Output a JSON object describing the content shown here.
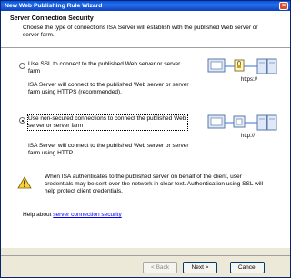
{
  "window": {
    "title": "New Web Publishing Rule Wizard",
    "close_glyph": "×"
  },
  "header": {
    "title": "Server Connection Security",
    "description": "Choose the type of connections ISA Server will establish with the published Web server or server farm."
  },
  "options": [
    {
      "label": "Use SSL to connect to the published Web server or server farm",
      "description": "ISA Server will connect to the published Web server or server farm using HTTPS (recommended).",
      "selected": false,
      "illustration_label": "https://"
    },
    {
      "label": "Use non-secured connections to connect the published Web server or server farm",
      "description": "ISA Server will connect to the published Web server or server farm using HTTP.",
      "selected": true,
      "illustration_label": "http://"
    }
  ],
  "warning": {
    "text": "When ISA authenticates to the published server on behalf of the client, user credentials may be sent over the network in clear text. Authentication using SSL will help protect client credentials."
  },
  "help": {
    "prefix": "Help about",
    "link": "server connection security"
  },
  "buttons": {
    "back": "< Back",
    "next": "Next >",
    "cancel": "Cancel"
  },
  "colors": {
    "title_bar": "#0054e3",
    "link": "#0000ee",
    "warning": "#f7d33b"
  }
}
